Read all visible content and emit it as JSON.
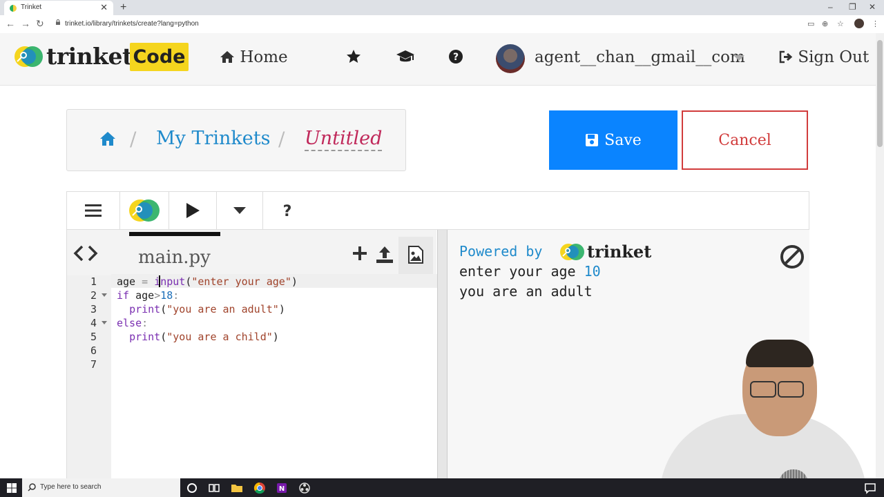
{
  "browser": {
    "tab_title": "Trinket",
    "tab_close": "✕",
    "new_tab": "+",
    "url": "trinket.io/library/trinkets/create?lang=python",
    "back": "←",
    "forward": "→",
    "reload": "↻",
    "window_minimize": "–",
    "window_restore": "❐",
    "window_close": "✕"
  },
  "header": {
    "logo_word": "trinket",
    "logo_badge": "Code",
    "home_label": "Home",
    "username": "agent__chan__gmail__com",
    "signout_label": "Sign Out",
    "icons": [
      "star-icon",
      "graduation-cap-icon",
      "question-circle-icon"
    ]
  },
  "breadcrumb": {
    "link": "My Trinkets",
    "title": "Untitled",
    "separator": "/"
  },
  "actions": {
    "save_label": "Save",
    "cancel_label": "Cancel"
  },
  "editor": {
    "filename": "main.py",
    "line_numbers": [
      "1",
      "2",
      "3",
      "4",
      "5",
      "6",
      "7"
    ],
    "code_lines": [
      "age = input(\"enter your age\")",
      "if age>18:",
      "  print(\"you are an adult\")",
      "else:",
      "  print(\"you are a child\")",
      "",
      ""
    ]
  },
  "output": {
    "powered_by": "Powered by",
    "powered_brand": "trinket",
    "prompt": "enter your age ",
    "prompt_input": "10",
    "result": "you are an adult"
  },
  "taskbar": {
    "search_placeholder": "Type here to search"
  },
  "colors": {
    "brand_yellow": "#f5d51e",
    "link_blue": "#1f8acb",
    "save_blue": "#0a84ff",
    "cancel_red": "#d13b3b",
    "title_magenta": "#c0285a"
  }
}
